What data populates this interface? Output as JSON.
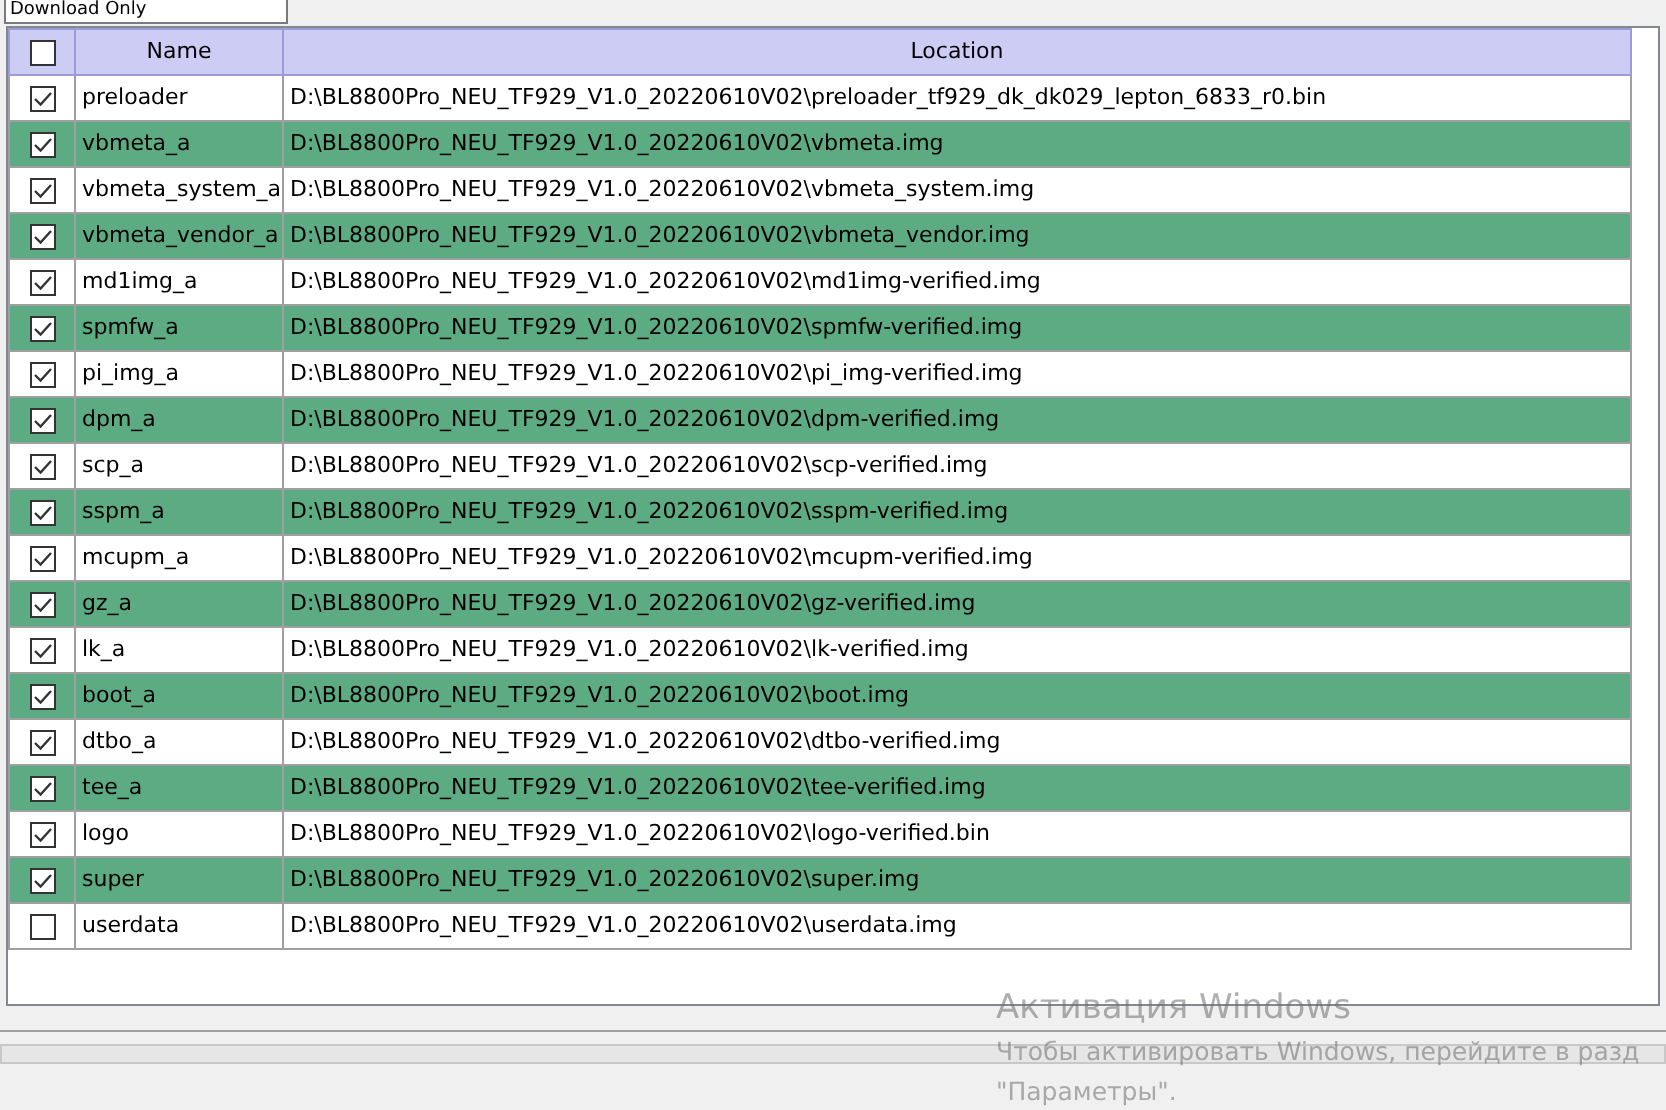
{
  "mode_dropdown": {
    "value": "Download Only"
  },
  "table": {
    "header_checked": false,
    "columns": [
      "Name",
      "Location"
    ],
    "rows": [
      {
        "checked": true,
        "name": "preloader",
        "location": "D:\\BL8800Pro_NEU_TF929_V1.0_20220610V02\\preloader_tf929_dk_dk029_lepton_6833_r0.bin"
      },
      {
        "checked": true,
        "name": "vbmeta_a",
        "location": "D:\\BL8800Pro_NEU_TF929_V1.0_20220610V02\\vbmeta.img"
      },
      {
        "checked": true,
        "name": "vbmeta_system_a",
        "location": "D:\\BL8800Pro_NEU_TF929_V1.0_20220610V02\\vbmeta_system.img"
      },
      {
        "checked": true,
        "name": "vbmeta_vendor_a",
        "location": "D:\\BL8800Pro_NEU_TF929_V1.0_20220610V02\\vbmeta_vendor.img"
      },
      {
        "checked": true,
        "name": "md1img_a",
        "location": "D:\\BL8800Pro_NEU_TF929_V1.0_20220610V02\\md1img-verified.img"
      },
      {
        "checked": true,
        "name": "spmfw_a",
        "location": "D:\\BL8800Pro_NEU_TF929_V1.0_20220610V02\\spmfw-verified.img"
      },
      {
        "checked": true,
        "name": "pi_img_a",
        "location": "D:\\BL8800Pro_NEU_TF929_V1.0_20220610V02\\pi_img-verified.img"
      },
      {
        "checked": true,
        "name": "dpm_a",
        "location": "D:\\BL8800Pro_NEU_TF929_V1.0_20220610V02\\dpm-verified.img"
      },
      {
        "checked": true,
        "name": "scp_a",
        "location": "D:\\BL8800Pro_NEU_TF929_V1.0_20220610V02\\scp-verified.img"
      },
      {
        "checked": true,
        "name": "sspm_a",
        "location": "D:\\BL8800Pro_NEU_TF929_V1.0_20220610V02\\sspm-verified.img"
      },
      {
        "checked": true,
        "name": "mcupm_a",
        "location": "D:\\BL8800Pro_NEU_TF929_V1.0_20220610V02\\mcupm-verified.img"
      },
      {
        "checked": true,
        "name": "gz_a",
        "location": "D:\\BL8800Pro_NEU_TF929_V1.0_20220610V02\\gz-verified.img"
      },
      {
        "checked": true,
        "name": "lk_a",
        "location": "D:\\BL8800Pro_NEU_TF929_V1.0_20220610V02\\lk-verified.img"
      },
      {
        "checked": true,
        "name": "boot_a",
        "location": "D:\\BL8800Pro_NEU_TF929_V1.0_20220610V02\\boot.img"
      },
      {
        "checked": true,
        "name": "dtbo_a",
        "location": "D:\\BL8800Pro_NEU_TF929_V1.0_20220610V02\\dtbo-verified.img"
      },
      {
        "checked": true,
        "name": "tee_a",
        "location": "D:\\BL8800Pro_NEU_TF929_V1.0_20220610V02\\tee-verified.img"
      },
      {
        "checked": true,
        "name": "logo",
        "location": "D:\\BL8800Pro_NEU_TF929_V1.0_20220610V02\\logo-verified.bin"
      },
      {
        "checked": true,
        "name": "super",
        "location": "D:\\BL8800Pro_NEU_TF929_V1.0_20220610V02\\super.img"
      },
      {
        "checked": false,
        "name": "userdata",
        "location": "D:\\BL8800Pro_NEU_TF929_V1.0_20220610V02\\userdata.img"
      }
    ]
  },
  "activation_notice": {
    "title": "Активация Windows",
    "text": "Чтобы активировать Windows, перейдите в разд",
    "text_2": "\"Параметры\"."
  }
}
